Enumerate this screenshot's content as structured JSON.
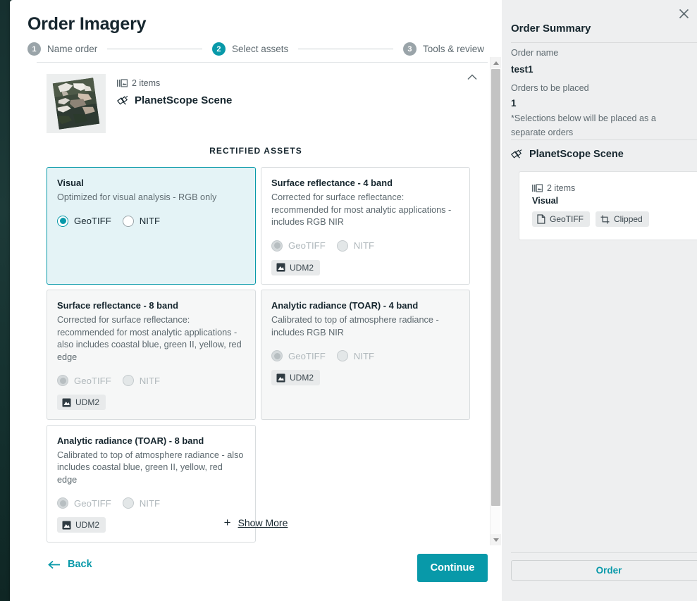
{
  "window": {
    "title": "Order Imagery"
  },
  "stepper": {
    "steps": [
      {
        "num": "1",
        "label": "Name order",
        "active": false
      },
      {
        "num": "2",
        "label": "Select assets",
        "active": true
      },
      {
        "num": "3",
        "label": "Tools & review",
        "active": false
      }
    ]
  },
  "scene": {
    "items_count": "2 items",
    "name": "PlanetScope Scene",
    "section_title": "RECTIFIED ASSETS"
  },
  "assets": [
    {
      "title": "Visual",
      "description": "Optimized for visual analysis - RGB only",
      "selected": true,
      "disabled": false,
      "options": [
        {
          "label": "GeoTIFF",
          "checked": true
        },
        {
          "label": "NITF",
          "checked": false
        }
      ],
      "badge": null
    },
    {
      "title": "Surface reflectance - 4 band",
      "description": "Corrected for surface reflectance: recommended for most analytic applications - includes RGB NIR",
      "selected": false,
      "disabled": true,
      "options": [
        {
          "label": "GeoTIFF",
          "checked": true
        },
        {
          "label": "NITF",
          "checked": false
        }
      ],
      "badge": "UDM2"
    },
    {
      "title": "Surface reflectance - 8 band",
      "description": "Corrected for surface reflectance: recommended for most analytic applications - also includes coastal blue, green II, yellow, red edge",
      "selected": false,
      "disabled": true,
      "options": [
        {
          "label": "GeoTIFF",
          "checked": true
        },
        {
          "label": "NITF",
          "checked": false
        }
      ],
      "badge": "UDM2"
    },
    {
      "title": "Analytic radiance (TOAR) - 4 band",
      "description": "Calibrated to top of atmosphere radiance - includes RGB NIR",
      "selected": false,
      "disabled": true,
      "options": [
        {
          "label": "GeoTIFF",
          "checked": true
        },
        {
          "label": "NITF",
          "checked": false
        }
      ],
      "badge": "UDM2"
    },
    {
      "title": "Analytic radiance (TOAR) - 8 band",
      "description": "Calibrated to top of atmosphere radiance - also includes coastal blue, green II, yellow, red edge",
      "selected": false,
      "disabled": true,
      "options": [
        {
          "label": "GeoTIFF",
          "checked": true
        },
        {
          "label": "NITF",
          "checked": false
        }
      ],
      "badge": "UDM2"
    }
  ],
  "show_more": {
    "label": "Show More",
    "plus": "+"
  },
  "footer": {
    "back_label": "Back",
    "continue_label": "Continue"
  },
  "summary": {
    "title": "Order Summary",
    "order_name_label": "Order name",
    "order_name_value": "test1",
    "orders_label": "Orders to be placed",
    "orders_value": "1",
    "note": "*Selections below will be placed as a separate orders",
    "scene_name": "PlanetScope Scene",
    "card": {
      "items_count": "2 items",
      "title": "Visual",
      "badges": [
        "GeoTIFF",
        "Clipped"
      ]
    },
    "order_button": "Order"
  },
  "colors": {
    "accent": "#0899a9",
    "selected_card_bg": "#e4f3f6",
    "text_dark": "#16262e",
    "text_muted": "#5e6a70",
    "panel_bg": "#eeeff0"
  }
}
